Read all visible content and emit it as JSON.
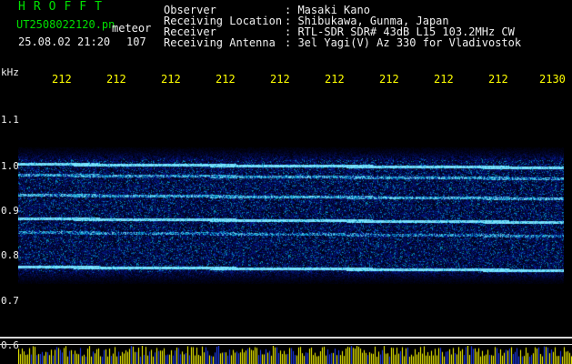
{
  "header": {
    "logo": "HROFFT",
    "filename": "UT2508022120.pn",
    "mode": "meteor",
    "datetime": "25.08.02 21:20",
    "count": "107",
    "info_labels": [
      "Observer",
      "Receiving Location",
      "Receiver",
      "Receiving Antenna"
    ],
    "info_values": [
      ": Masaki Kano",
      ": Shibukawa, Gunma, Japan",
      ": RTL-SDR SDR# 43dB L15 103.2MHz CW",
      ": 3el Yagi(V) Az 330 for Vladivostok"
    ]
  },
  "axis": {
    "unit_label": "kHz",
    "x_ticks": [
      "212",
      "212",
      "212",
      "212",
      "212",
      "212",
      "212",
      "212",
      "212",
      "2130"
    ],
    "y_ticks": [
      "1.1",
      "1.0",
      "0.9",
      "0.8",
      "0.7",
      "0.6"
    ]
  },
  "colors": {
    "background": "#000000",
    "text_green": "#00e000",
    "text_yellow": "#ffff00",
    "noise_blue": "#0a2a9a",
    "trace_cyan": "#40e0ff"
  }
}
